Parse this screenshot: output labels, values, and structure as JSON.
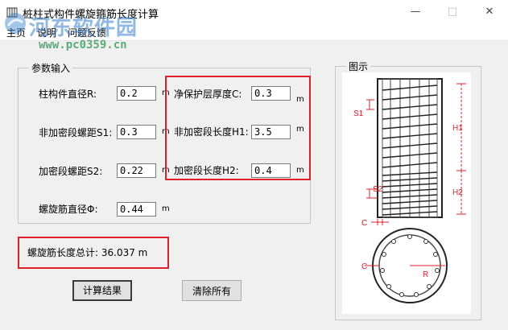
{
  "window": {
    "title": "桩柱式构件螺旋箍筋长度计算",
    "minimize_icon": "minimize-icon",
    "maximize_icon": "maximize-icon",
    "close_icon": "close-icon"
  },
  "menu": {
    "items": [
      "主页",
      "说明",
      "问题反馈"
    ]
  },
  "watermark": {
    "line1": "河东软件园",
    "line2": "www.pc0359.cn"
  },
  "params": {
    "group_title": "参数输入",
    "fields": [
      {
        "label": "柱构件直径R:",
        "value": "0.2",
        "unit": "m"
      },
      {
        "label": "非加密段螺距S1:",
        "value": "0.3",
        "unit": "m"
      },
      {
        "label": "加密段螺距S2:",
        "value": "0.22",
        "unit": "m"
      },
      {
        "label": "螺旋筋直径Φ:",
        "value": "0.44",
        "unit": "m"
      },
      {
        "label": "净保护层厚度C:",
        "value": "0.3",
        "unit": "m"
      },
      {
        "label": "非加密段长度H1:",
        "value": "3.5",
        "unit": "m"
      },
      {
        "label": "加密段长度H2:",
        "value": "0.4",
        "unit": "m"
      }
    ]
  },
  "result": {
    "text": "螺旋筋长度总计: 36.037 m"
  },
  "buttons": {
    "calculate": "计算结果",
    "clear": "清除所有"
  },
  "diagram": {
    "group_title": "图示",
    "labels": {
      "s1": "S1",
      "s2": "S2",
      "h1": "H1",
      "h2": "H2",
      "c": "C",
      "r": "R"
    }
  },
  "colors": {
    "highlight": "#e0202a",
    "diagram_dim": "#e0202a"
  }
}
